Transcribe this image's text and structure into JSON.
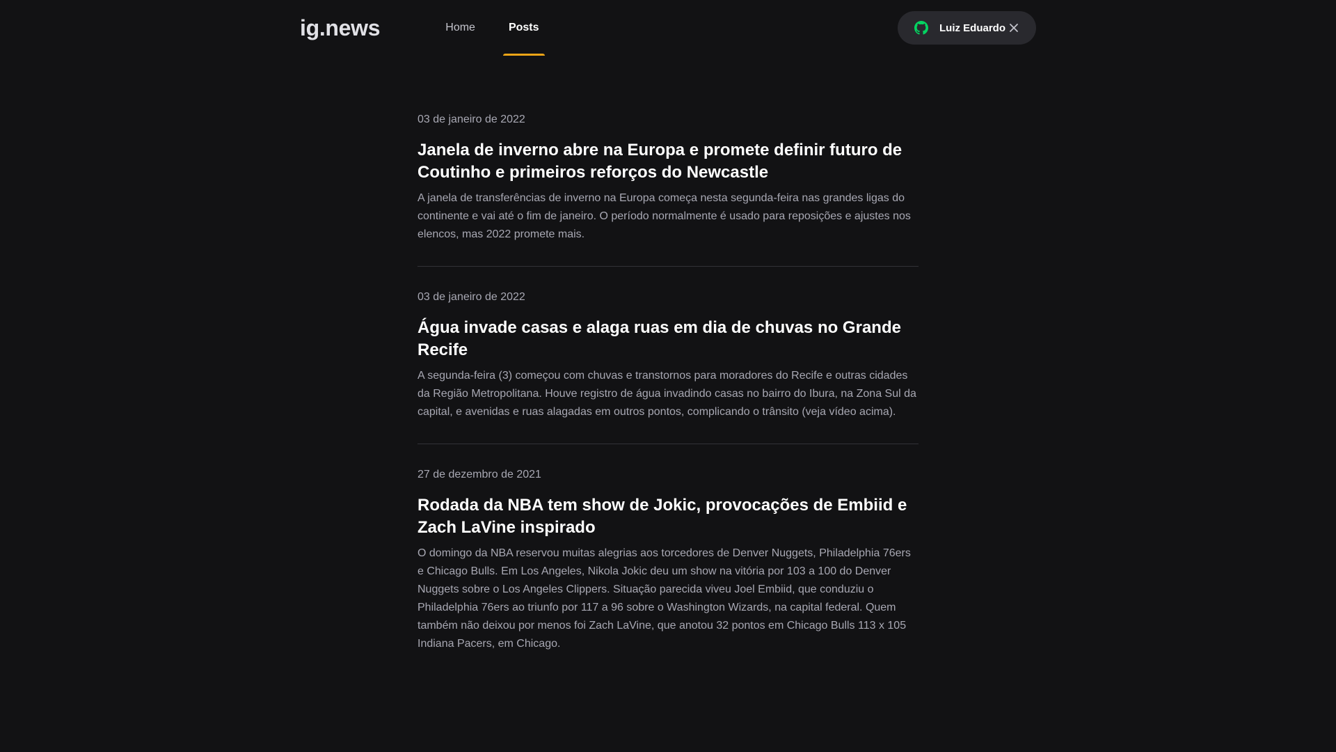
{
  "header": {
    "logo": "ig.news",
    "nav": [
      {
        "label": "Home",
        "active": false
      },
      {
        "label": "Posts",
        "active": true
      }
    ],
    "user": {
      "name": "Luiz Eduardo",
      "icon": "github-icon",
      "icon_color": "#04d361",
      "close_icon": "close-icon"
    },
    "accent_color": "#eba417"
  },
  "posts": [
    {
      "date": "03 de janeiro de 2022",
      "title": "Janela de inverno abre na Europa e promete definir futuro de Coutinho e primeiros reforços do Newcastle",
      "excerpt": "A janela de transferências de inverno na Europa começa nesta segunda-feira nas grandes ligas do continente e vai até o fim de janeiro. O período normalmente é usado para reposições e ajustes nos elencos, mas 2022 promete mais."
    },
    {
      "date": "03 de janeiro de 2022",
      "title": "Água invade casas e alaga ruas em dia de chuvas no Grande Recife",
      "excerpt": "A segunda-feira (3) começou com chuvas e transtornos para moradores do Recife e outras cidades da Região Metropolitana. Houve registro de água invadindo casas no bairro do Ibura, na Zona Sul da capital, e avenidas e ruas alagadas em outros pontos, complicando o trânsito (veja vídeo acima)."
    },
    {
      "date": "27 de dezembro de 2021",
      "title": "Rodada da NBA tem show de Jokic, provocações de Embiid e Zach LaVine inspirado",
      "excerpt": "O domingo da NBA reservou muitas alegrias aos torcedores de Denver Nuggets, Philadelphia 76ers e Chicago Bulls. Em Los Angeles, Nikola Jokic deu um show na vitória por 103 a 100 do Denver Nuggets sobre o Los Angeles Clippers. Situação parecida viveu Joel Embiid, que conduziu o Philadelphia 76ers ao triunfo por 117 a 96 sobre o Washington Wizards, na capital federal. Quem também não deixou por menos foi Zach LaVine, que anotou 32 pontos em Chicago Bulls 113 x 105 Indiana Pacers, em Chicago."
    }
  ]
}
